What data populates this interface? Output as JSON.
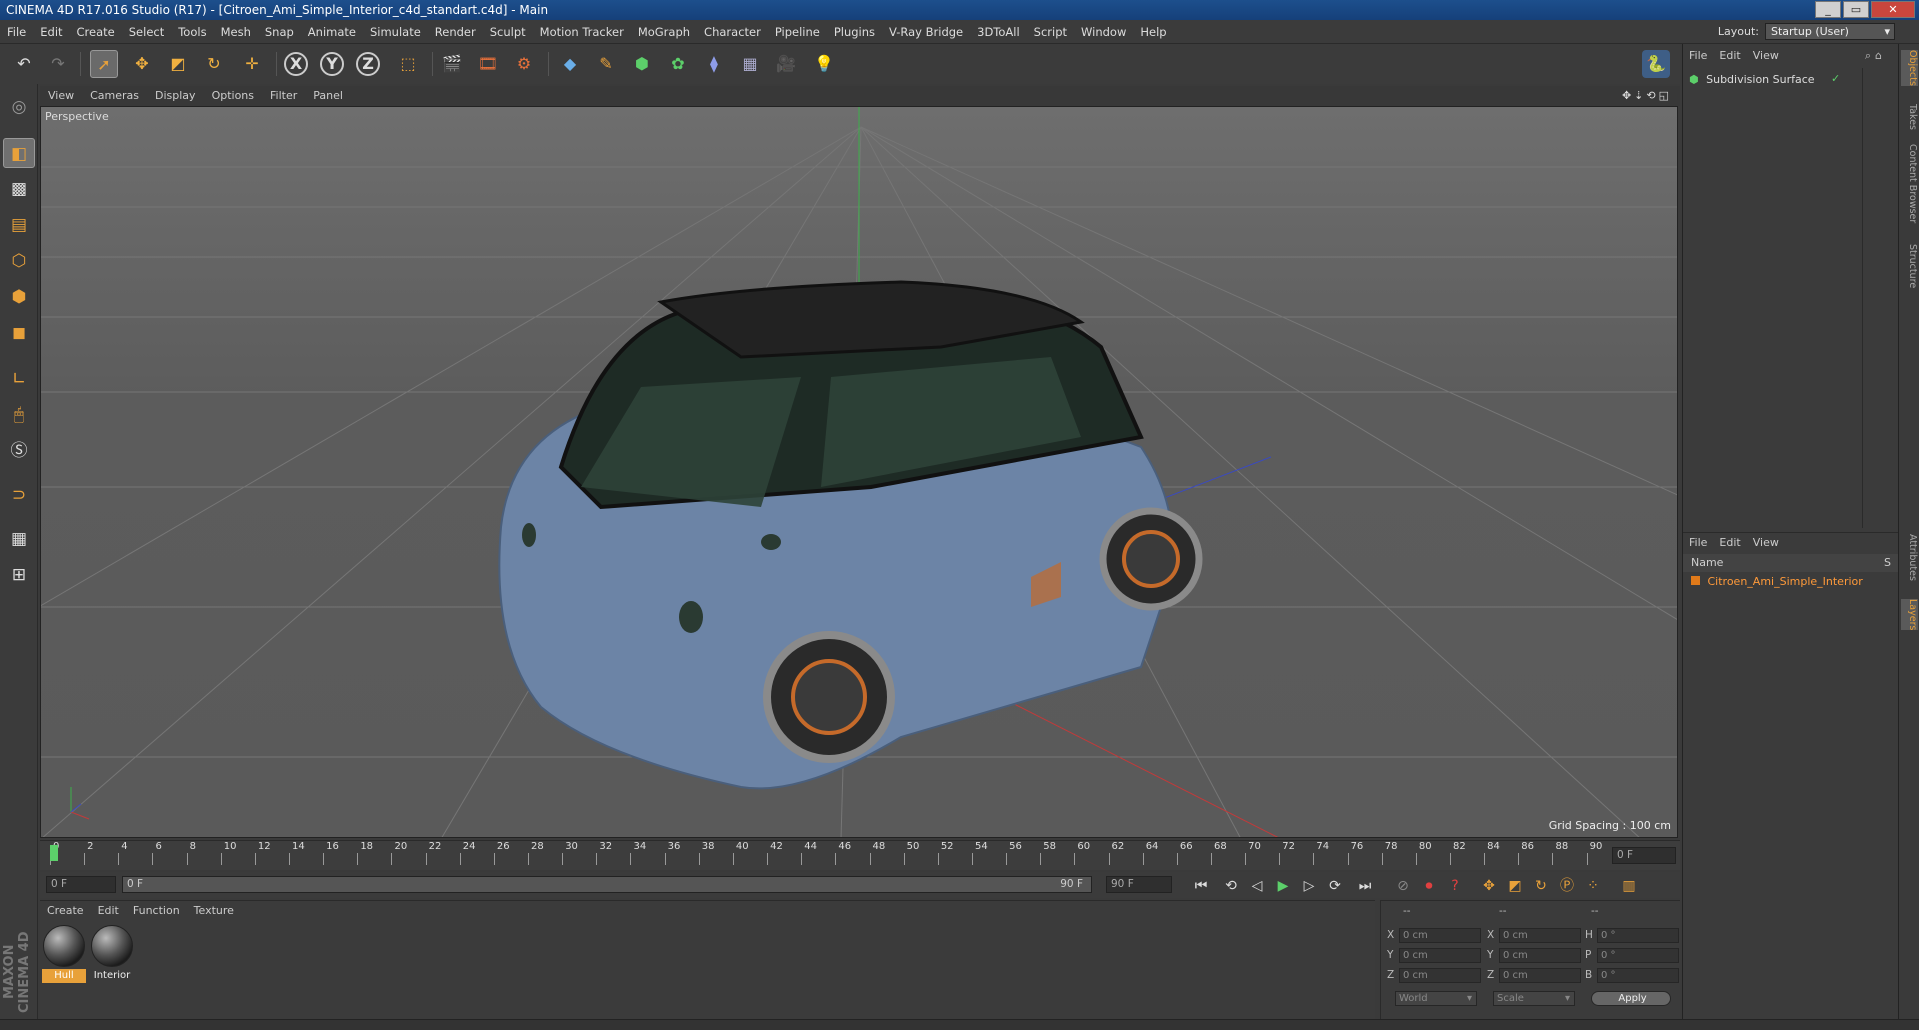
{
  "window": {
    "title": "CINEMA 4D R17.016 Studio (R17) - [Citroen_Ami_Simple_Interior_c4d_standart.c4d] - Main",
    "controls": [
      "_",
      "▭",
      "✕"
    ]
  },
  "menubar": {
    "items": [
      "File",
      "Edit",
      "Create",
      "Select",
      "Tools",
      "Mesh",
      "Snap",
      "Animate",
      "Simulate",
      "Render",
      "Sculpt",
      "Motion Tracker",
      "MoGraph",
      "Character",
      "Pipeline",
      "Plugins",
      "V-Ray Bridge",
      "3DToAll",
      "Script",
      "Window",
      "Help"
    ],
    "layout_label": "Layout:",
    "layout_value": "Startup (User)"
  },
  "toolbar": {
    "axis_x": "X",
    "axis_y": "Y",
    "axis_z": "Z"
  },
  "viewport": {
    "menu": [
      "View",
      "Cameras",
      "Display",
      "Options",
      "Filter",
      "Panel"
    ],
    "label": "Perspective",
    "grid_spacing": "Grid Spacing : 100 cm"
  },
  "timeline": {
    "ticks": [
      "0",
      "2",
      "4",
      "6",
      "8",
      "10",
      "12",
      "14",
      "16",
      "18",
      "20",
      "22",
      "24",
      "26",
      "28",
      "30",
      "32",
      "34",
      "36",
      "38",
      "40",
      "42",
      "44",
      "46",
      "48",
      "50",
      "52",
      "54",
      "56",
      "58",
      "60",
      "62",
      "64",
      "66",
      "68",
      "70",
      "72",
      "74",
      "76",
      "78",
      "80",
      "82",
      "84",
      "86",
      "88",
      "90"
    ],
    "current_frame": "0 F",
    "start": "0 F",
    "range_start": "0 F",
    "range_end": "90 F",
    "end": "90 F"
  },
  "materials": {
    "menu": [
      "Create",
      "Edit",
      "Function",
      "Texture"
    ],
    "items": [
      {
        "name": "Hull",
        "selected": true
      },
      {
        "name": "Interior",
        "selected": false
      }
    ]
  },
  "coords": {
    "header": [
      "--",
      "--",
      "--"
    ],
    "rows": [
      {
        "a": "X",
        "av": "0 cm",
        "b": "X",
        "bv": "0 cm",
        "c": "H",
        "cv": "0 °"
      },
      {
        "a": "Y",
        "av": "0 cm",
        "b": "Y",
        "bv": "0 cm",
        "c": "P",
        "cv": "0 °"
      },
      {
        "a": "Z",
        "av": "0 cm",
        "b": "Z",
        "bv": "0 cm",
        "c": "B",
        "cv": "0 °"
      }
    ],
    "mode1": "World",
    "mode2": "Scale",
    "apply": "Apply"
  },
  "objects": {
    "menu": [
      "File",
      "Edit",
      "View"
    ],
    "items": [
      {
        "name": "Subdivision Surface"
      }
    ]
  },
  "layers": {
    "menu": [
      "File",
      "Edit",
      "View"
    ],
    "header": "Name",
    "header_s": "S",
    "items": [
      {
        "name": "Citroen_Ami_Simple_Interior",
        "color": "#e07a1a"
      }
    ]
  },
  "side_tabs": [
    "Objects",
    "Takes",
    "Content Browser",
    "Structure",
    "Attributes",
    "Layers"
  ],
  "brand": "MAXON CINEMA 4D",
  "colors": {
    "accent": "#e8a13a",
    "car_body": "#6c84a6",
    "layer_text": "#ff9a3a"
  }
}
